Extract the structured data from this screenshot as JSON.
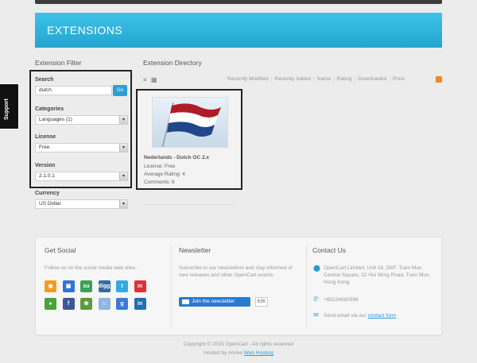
{
  "header": {
    "title": "EXTENSIONS"
  },
  "support": {
    "label": "Support"
  },
  "filter": {
    "title": "Extension Filter",
    "search": {
      "label": "Search",
      "value": "dutch",
      "go": "Go"
    },
    "categories": {
      "label": "Categories",
      "value": "Languages (1)"
    },
    "license": {
      "label": "License",
      "value": "Free"
    },
    "version": {
      "label": "Version",
      "value": "2.1.0.1"
    },
    "currency": {
      "label": "Currency",
      "value": "US Dollar"
    }
  },
  "directory": {
    "title": "Extension Directory",
    "sort": [
      "Recently Modified",
      "Recently Added",
      "Name",
      "Rating",
      "Downloaded",
      "Price"
    ],
    "item": {
      "name": "Nederlands - Dutch OC 2.x",
      "license": "License: Free",
      "rating": "Average Rating: 4",
      "comments": "Comments: 8"
    }
  },
  "footer": {
    "social": {
      "title": "Get Social",
      "text": "Follow us on the social media web sites.",
      "icons": [
        {
          "name": "rss",
          "glyph": "◉",
          "color": "#f29b26"
        },
        {
          "name": "delicious",
          "glyph": "▣",
          "color": "#3274d1"
        },
        {
          "name": "stumbleupon",
          "glyph": "su",
          "color": "#3aa157"
        },
        {
          "name": "digg",
          "glyph": "digg",
          "color": "#356aa0"
        },
        {
          "name": "twitter",
          "glyph": "t",
          "color": "#36a9e1"
        },
        {
          "name": "myspace",
          "glyph": "m",
          "color": "#d8343a"
        },
        {
          "name": "chat",
          "glyph": "●",
          "color": "#4aa23a"
        },
        {
          "name": "facebook",
          "glyph": "f",
          "color": "#3b5998"
        },
        {
          "name": "yelp",
          "glyph": "❀",
          "color": "#5d9c36"
        },
        {
          "name": "reddit",
          "glyph": "☺",
          "color": "#8fb7e0"
        },
        {
          "name": "google",
          "glyph": "g",
          "color": "#3a7bd5"
        },
        {
          "name": "linkedin",
          "glyph": "in",
          "color": "#1f6fb2"
        }
      ]
    },
    "newsletter": {
      "title": "Newsletter",
      "text": "Subscribe to our newsletters and stay informed of new releases and other OpenCart events.",
      "button": "Join the newsletter",
      "count": "63K"
    },
    "contact": {
      "title": "Contact Us",
      "address": "OpenCart Limited, Unit 16, 26/F, Tuen Mun Central Square, 22 Hoi Wing Road, Tuen Mun, Hong Kong",
      "phone": "+85224880596",
      "email_prefix": "Send email via our",
      "email_link": "contact form"
    }
  },
  "copyright": {
    "line1": "Copyright © 2015 OpenCart - All rights reserved",
    "line2_prefix": "Hosted by Arvixe",
    "line2_link": "Web Hosting"
  }
}
